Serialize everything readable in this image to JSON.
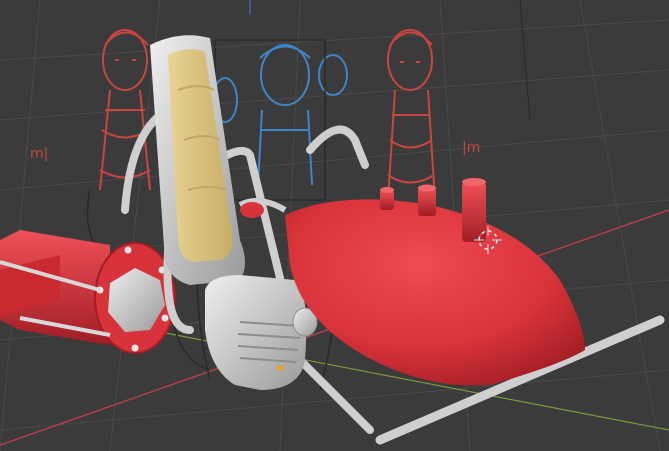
{
  "viewport": {
    "kind": "3d-viewport",
    "background": "#3b3b3b",
    "grid_color": "#4a4a4a",
    "axis_x_color": "#b0404a",
    "axis_y_color": "#7a9a3a",
    "axis_z_color": "#4a6ab0",
    "scene": {
      "model": "red-pod-vehicle-with-seat",
      "body_color": "#d8323a",
      "metal_color": "#cfcfcf",
      "seat_color": "#e6cc86",
      "reference_sketch_red": "#c84640",
      "reference_sketch_blue": "#3f86c8",
      "reference_sketch_dark": "#2a2a2a"
    },
    "annotations": [
      {
        "id": "left",
        "text": "m|"
      },
      {
        "id": "right",
        "text": "|m"
      }
    ],
    "cursor_icon": "3d-cursor-icon"
  }
}
